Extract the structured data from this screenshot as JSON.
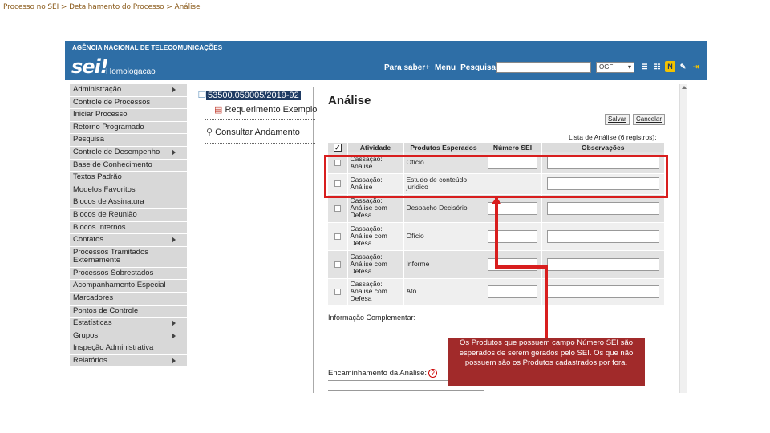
{
  "breadcrumb": "Processo no SEI > Detalhamento do Processo > Análise",
  "header": {
    "agency": "AGÊNCIA NACIONAL DE TELECOMUNICAÇÕES",
    "logo": "sei!",
    "environment": "Homologacao",
    "nav": [
      "Para saber+",
      "Menu",
      "Pesquisa"
    ],
    "unit_select": "OGFI",
    "icons": [
      "menu-icon",
      "user-icon",
      "n-icon",
      "settings-icon",
      "exit-icon"
    ]
  },
  "sidebar": {
    "items": [
      {
        "label": "Administração",
        "arrow": true
      },
      {
        "label": "Controle de Processos",
        "arrow": false
      },
      {
        "label": "Iniciar Processo",
        "arrow": false
      },
      {
        "label": "Retorno Programado",
        "arrow": false
      },
      {
        "label": "Pesquisa",
        "arrow": false
      },
      {
        "label": "Controle de Desempenho",
        "arrow": true
      },
      {
        "label": "Base de Conhecimento",
        "arrow": false
      },
      {
        "label": "Textos Padrão",
        "arrow": false
      },
      {
        "label": "Modelos Favoritos",
        "arrow": false
      },
      {
        "label": "Blocos de Assinatura",
        "arrow": false
      },
      {
        "label": "Blocos de Reunião",
        "arrow": false
      },
      {
        "label": "Blocos Internos",
        "arrow": false
      },
      {
        "label": "Contatos",
        "arrow": true
      },
      {
        "label": "Processos Tramitados Externamente",
        "arrow": false
      },
      {
        "label": "Processos Sobrestados",
        "arrow": false
      },
      {
        "label": "Acompanhamento Especial",
        "arrow": false
      },
      {
        "label": "Marcadores",
        "arrow": false
      },
      {
        "label": "Pontos de Controle",
        "arrow": false
      },
      {
        "label": "Estatísticas",
        "arrow": true
      },
      {
        "label": "Grupos",
        "arrow": true
      },
      {
        "label": "Inspeção Administrativa",
        "arrow": false
      },
      {
        "label": "Relatórios",
        "arrow": true
      }
    ]
  },
  "tree": {
    "process_number": "53500.059005/2019-92",
    "document": "Requerimento Exemplo",
    "consult": "Consultar Andamento"
  },
  "main": {
    "title": "Análise",
    "save_label": "Salvar",
    "cancel_label": "Cancelar",
    "list_caption": "Lista de Análise (6 registros):",
    "columns": [
      "",
      "Atividade",
      "Produtos Esperados",
      "Número SEI",
      "Observações"
    ],
    "rows": [
      {
        "atividade": "Cassação: Análise",
        "produto": "Ofício",
        "numero_field": true
      },
      {
        "atividade": "Cassação: Análise",
        "produto": "Estudo de conteúdo jurídico",
        "numero_field": false
      },
      {
        "atividade": "Cassação: Análise com Defesa",
        "produto": "Despacho Decisório",
        "numero_field": true
      },
      {
        "atividade": "Cassação: Análise com Defesa",
        "produto": "Ofício",
        "numero_field": true
      },
      {
        "atividade": "Cassação: Análise com Defesa",
        "produto": "Informe",
        "numero_field": true
      },
      {
        "atividade": "Cassação: Análise com Defesa",
        "produto": "Ato",
        "numero_field": true
      }
    ],
    "info_label": "Informação Complementar:",
    "encaminhamento_label": "Encaminhamento da Análise:"
  },
  "callout": {
    "text": "Os Produtos que possuem campo Número SEI são esperados de serem gerados pelo SEI. Os que não possuem são os Produtos cadastrados por fora.",
    "color": "#a12a2a",
    "highlight_color": "#d81e1e"
  }
}
